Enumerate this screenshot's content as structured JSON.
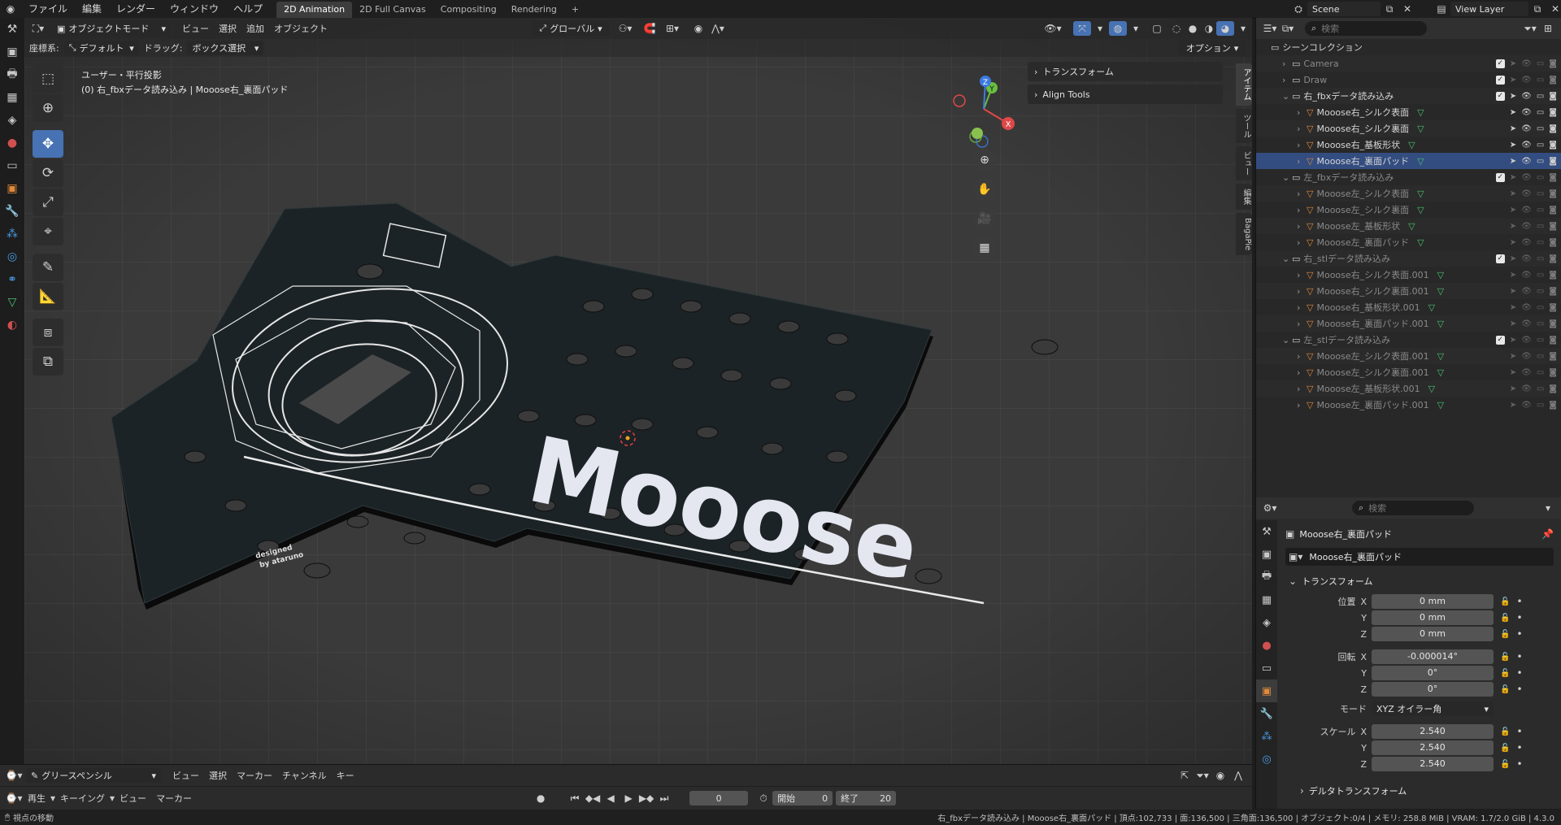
{
  "menu": {
    "items": [
      "ファイル",
      "編集",
      "レンダー",
      "ウィンドウ",
      "ヘルプ"
    ],
    "workspace_tabs": [
      "2D Animation",
      "2D Full Canvas",
      "Compositing",
      "Rendering"
    ],
    "add_tab": "+",
    "scene_name": "Scene",
    "view_layer": "View Layer"
  },
  "viewport": {
    "mode": "オブジェクトモード",
    "menus": [
      "ビュー",
      "選択",
      "追加",
      "オブジェクト"
    ],
    "transform_orientation": "グローバル",
    "coord_label": "座標系:",
    "coord_value": "デフォルト",
    "drag_label": "ドラッグ:",
    "drag_value": "ボックス選択",
    "options": "オプション",
    "view_name": "ユーザー・平行投影",
    "object_info": "(0) 右_fbxデータ読み込み | Mooose右_裏面パッド",
    "gizmo_x": "X",
    "gizmo_y": "Y",
    "gizmo_z": "Z"
  },
  "npanel": {
    "sections": [
      "トランスフォーム",
      "Align Tools"
    ],
    "tabs": [
      "アイテム",
      "ツール",
      "ビュー",
      "編集",
      "BagaPie"
    ]
  },
  "pcb": {
    "logo": "Mooose",
    "credit_line1": "designed",
    "credit_line2": "by ataruno"
  },
  "outliner": {
    "search_placeholder": "検索",
    "root": "シーンコレクション",
    "rows": [
      {
        "label": "Camera",
        "indent": 1,
        "kind": "collection",
        "dim": true
      },
      {
        "label": "Draw",
        "indent": 1,
        "kind": "collection",
        "dim": true
      },
      {
        "label": "右_fbxデータ読み込み",
        "indent": 1,
        "kind": "collection",
        "dim": false,
        "open": true
      },
      {
        "label": "Mooose右_シルク表面",
        "indent": 2,
        "kind": "mesh",
        "dim": false
      },
      {
        "label": "Mooose右_シルク裏面",
        "indent": 2,
        "kind": "mesh",
        "dim": false
      },
      {
        "label": "Mooose右_基板形状",
        "indent": 2,
        "kind": "mesh",
        "dim": false
      },
      {
        "label": "Mooose右_裏面パッド",
        "indent": 2,
        "kind": "mesh",
        "dim": false,
        "active": true
      },
      {
        "label": "左_fbxデータ読み込み",
        "indent": 1,
        "kind": "collection",
        "dim": true,
        "open": true
      },
      {
        "label": "Mooose左_シルク表面",
        "indent": 2,
        "kind": "mesh",
        "dim": true
      },
      {
        "label": "Mooose左_シルク裏面",
        "indent": 2,
        "kind": "mesh",
        "dim": true
      },
      {
        "label": "Mooose左_基板形状",
        "indent": 2,
        "kind": "mesh",
        "dim": true
      },
      {
        "label": "Mooose左_裏面パッド",
        "indent": 2,
        "kind": "mesh",
        "dim": true
      },
      {
        "label": "右_stlデータ読み込み",
        "indent": 1,
        "kind": "collection",
        "dim": true,
        "open": true
      },
      {
        "label": "Mooose右_シルク表面.001",
        "indent": 2,
        "kind": "mesh",
        "dim": true
      },
      {
        "label": "Mooose右_シルク裏面.001",
        "indent": 2,
        "kind": "mesh",
        "dim": true
      },
      {
        "label": "Mooose右_基板形状.001",
        "indent": 2,
        "kind": "mesh",
        "dim": true
      },
      {
        "label": "Mooose右_裏面パッド.001",
        "indent": 2,
        "kind": "mesh",
        "dim": true
      },
      {
        "label": "左_stlデータ読み込み",
        "indent": 1,
        "kind": "collection",
        "dim": true,
        "open": true
      },
      {
        "label": "Mooose左_シルク表面.001",
        "indent": 2,
        "kind": "mesh",
        "dim": true
      },
      {
        "label": "Mooose左_シルク裏面.001",
        "indent": 2,
        "kind": "mesh",
        "dim": true
      },
      {
        "label": "Mooose左_基板形状.001",
        "indent": 2,
        "kind": "mesh",
        "dim": true
      },
      {
        "label": "Mooose左_裏面パッド.001",
        "indent": 2,
        "kind": "mesh",
        "dim": true
      }
    ]
  },
  "properties": {
    "search_placeholder": "検索",
    "object_name": "Mooose右_裏面パッド",
    "object_field": "Mooose右_裏面パッド",
    "transform_header": "トランスフォーム",
    "location_label": "位置",
    "location": [
      "0 mm",
      "0 mm",
      "0 mm"
    ],
    "rotation_label": "回転",
    "rotation": [
      "-0.000014°",
      "0°",
      "0°"
    ],
    "mode_label": "モード",
    "mode_value": "XYZ オイラー角",
    "scale_label": "スケール",
    "scale": [
      "2.540",
      "2.540",
      "2.540"
    ],
    "axis": [
      "X",
      "Y",
      "Z"
    ],
    "delta": "デルタトランスフォーム"
  },
  "timeline": {
    "editor": "グリースペンシル",
    "menus1": [
      "ビュー",
      "選択",
      "マーカー",
      "チャンネル",
      "キー"
    ],
    "playback": "再生",
    "keying": "キーイング",
    "menus2": [
      "ビュー",
      "マーカー"
    ],
    "current_frame": "0",
    "start_label": "開始",
    "start": "0",
    "end_label": "終了",
    "end": "20"
  },
  "status": {
    "left": "視点の移動",
    "right": "右_fbxデータ読み込み | Mooose右_裏面パッド | 頂点:102,733 | 面:136,500 | 三角面:136,500 | オブジェクト:0/4 | メモリ: 258.8 MiB | VRAM: 1.7/2.0 GiB | 4.3.0"
  }
}
